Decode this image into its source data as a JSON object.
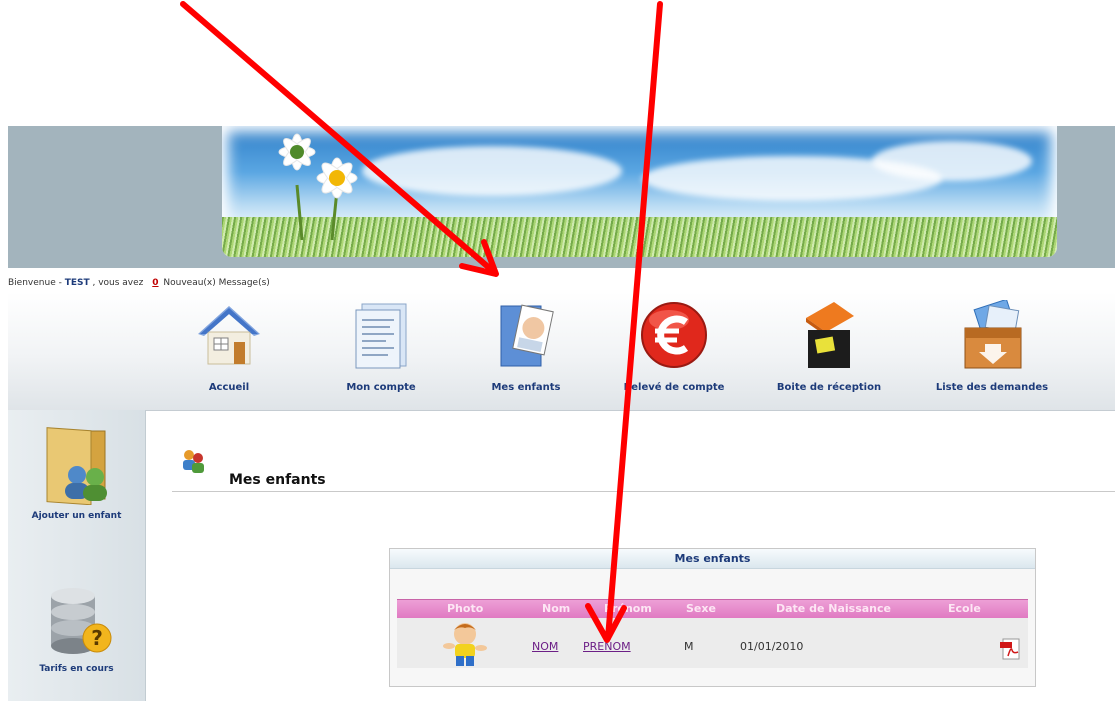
{
  "welcome": {
    "greeting": "Bienvenue - ",
    "user": "TEST",
    "middle": " , vous avez ",
    "count": "0",
    "suffix": " Nouveau(x) Message(s)"
  },
  "menu": [
    {
      "label": "Accueil",
      "icon": "house-icon"
    },
    {
      "label": "Mon compte",
      "icon": "document-icon"
    },
    {
      "label": "Mes enfants",
      "icon": "child-photo-icon"
    },
    {
      "label": "Relevé de compte",
      "icon": "euro-icon"
    },
    {
      "label": "Boite de réception",
      "icon": "inbox-icon"
    },
    {
      "label": "Liste des demandes",
      "icon": "box-icon"
    }
  ],
  "sidebar": [
    {
      "label": "Ajouter un enfant",
      "icon": "folder-users-icon"
    },
    {
      "label": "Tarifs en cours",
      "icon": "database-question-icon"
    }
  ],
  "page": {
    "title": "Mes enfants"
  },
  "table": {
    "title": "Mes enfants",
    "columns": [
      "Photo",
      "Nom",
      "Prénom",
      "Sexe",
      "Date de Naissance",
      "Ecole"
    ],
    "rows": [
      {
        "nom": "NOM",
        "prenom": "PRENOM",
        "sexe": "M",
        "naissance": "01/01/2010"
      }
    ]
  },
  "colors": {
    "annotation_arrow": "#ff0000",
    "header_pink": "#e07ac2",
    "link": "#6c1f86",
    "nav_text": "#1d3b7a"
  }
}
